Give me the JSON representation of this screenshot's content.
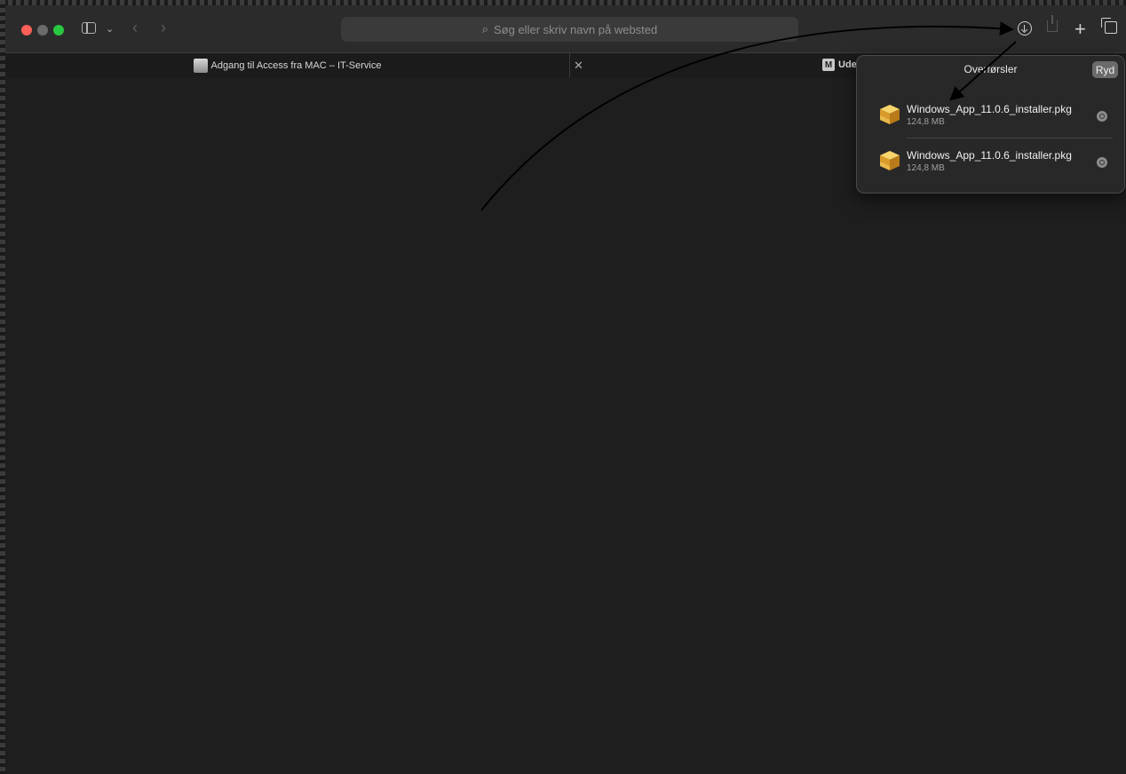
{
  "window": {
    "address_placeholder": "Søg eller skriv navn på websted"
  },
  "tabs": [
    {
      "label": "Adgang til Access fra MAC – IT-Service"
    },
    {
      "label": "Ude",
      "favicon_letter": "M"
    }
  ],
  "downloads": {
    "title": "Overførsler",
    "clear_label": "Ryd",
    "items": [
      {
        "name": "Windows_App_11.0.6_installer.pkg",
        "size": "124,8 MB"
      },
      {
        "name": "Windows_App_11.0.6_installer.pkg",
        "size": "124,8 MB"
      }
    ]
  },
  "colors": {
    "close": "#ff5f57",
    "minimize": "#6b6b6b",
    "maximize": "#28c840",
    "background": "#1e1e1e"
  },
  "icons": [
    "sidebar-icon",
    "chevron-down-icon",
    "back-icon",
    "forward-icon",
    "search-icon",
    "download-icon",
    "share-icon",
    "plus-icon",
    "tab-overview-icon",
    "package-icon",
    "magnifier-icon"
  ]
}
